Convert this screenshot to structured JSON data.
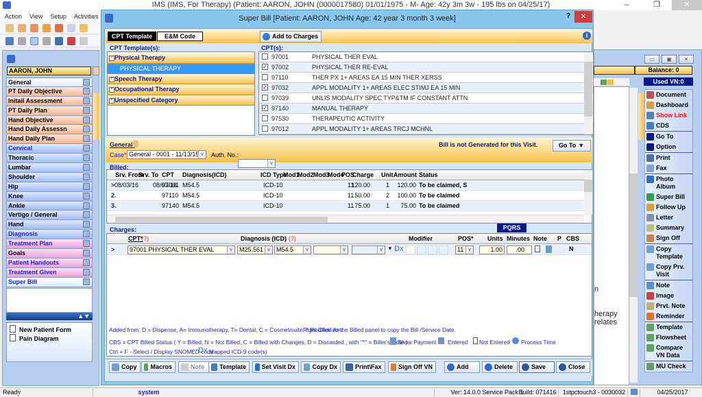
{
  "app": {
    "title": "IMS (IMS, For Therapy)    (Patient: AARON, JOHN  (0000017580) 01/01/1975 - M- Age: 42y 3m 3w - 195 lbs on 04/25/17)",
    "menu": [
      "Action",
      "View",
      "Setup",
      "Activities"
    ],
    "window_controls": [
      "–",
      "❐",
      "✕"
    ]
  },
  "left": {
    "patient_name": "AARON, JOHN",
    "nav": [
      {
        "label": "General",
        "style": "w",
        "color": "black"
      },
      {
        "label": "PT Daily Objective",
        "style": "o",
        "color": "black"
      },
      {
        "label": "Initail Assessment",
        "style": "o",
        "color": "black"
      },
      {
        "label": "PT Daily Plan",
        "style": "o",
        "color": "black"
      },
      {
        "label": "Hand Objective",
        "style": "o",
        "color": "black"
      },
      {
        "label": "Hand Daily Assessn",
        "style": "o",
        "color": "black"
      },
      {
        "label": "Hand Daily Plan",
        "style": "o",
        "color": "black"
      },
      {
        "label": "Cervical",
        "style": "bl",
        "color": "blue"
      },
      {
        "label": "Thoracic",
        "style": "bl",
        "color": "black"
      },
      {
        "label": "Lumbar",
        "style": "bl",
        "color": "black"
      },
      {
        "label": "Shoulder",
        "style": "bl",
        "color": "black"
      },
      {
        "label": "Hip",
        "style": "bl",
        "color": "black"
      },
      {
        "label": "Knee",
        "style": "bl",
        "color": "black"
      },
      {
        "label": "Ankle",
        "style": "bl",
        "color": "black"
      },
      {
        "label": "Vertigo / General",
        "style": "bl",
        "color": "black"
      },
      {
        "label": "Hand",
        "style": "bl",
        "color": "black"
      },
      {
        "label": "Diagnosis",
        "style": "bl",
        "color": "blue"
      },
      {
        "label": "Treatment Plan",
        "style": "p",
        "color": "blue"
      },
      {
        "label": "Goals",
        "style": "p",
        "color": "black"
      },
      {
        "label": "Patient Handouts",
        "style": "p",
        "color": "blue"
      },
      {
        "label": "Treatment Given",
        "style": "p",
        "color": "blue"
      },
      {
        "label": "Super Bill",
        "style": "w",
        "color": "blue"
      }
    ],
    "nav_arrows": "▲▼",
    "forms": [
      "New Patient Form",
      "Pain Diagram"
    ]
  },
  "right": {
    "balance": "Balance: 0",
    "used_vn": "Used VN:0",
    "text_fragments": [
      "n",
      "herapy",
      "relates"
    ],
    "sidebar": [
      {
        "label": "Document",
        "icon": "document-icon",
        "color": "#c05050"
      },
      {
        "label": "Dashboard",
        "icon": "dashboard-icon",
        "color": "#d0a040"
      },
      {
        "label": "Show Link",
        "icon": "link-icon",
        "color": "#5080c0",
        "red": true
      },
      {
        "label": "CDS",
        "icon": "cds-icon",
        "color": "#4080c0"
      },
      {
        "label": "Go To",
        "icon": "triangle-down-icon",
        "color": "#0a1a8a",
        "sep": true
      },
      {
        "label": "Option",
        "icon": "triangle-down-icon",
        "color": "#0a1a8a"
      },
      {
        "label": "Print",
        "icon": "print-icon",
        "color": "#5070a0",
        "sep": true
      },
      {
        "label": "Fax",
        "icon": "fax-icon",
        "color": "#80a0d0"
      },
      {
        "label": "Photo Album",
        "icon": "photo-album-icon",
        "color": "#3070c0",
        "sep": true
      },
      {
        "label": "Super Bill",
        "icon": "super-bill-icon",
        "color": "#30a050"
      },
      {
        "label": "Follow Up",
        "icon": "follow-up-icon",
        "color": "#e0a030"
      },
      {
        "label": "Letter",
        "icon": "letter-icon",
        "color": "#8090b0"
      },
      {
        "label": "Summary",
        "icon": "summary-icon",
        "color": "#c0c080"
      },
      {
        "label": "Sign Off",
        "icon": "sign-off-icon",
        "color": "#d08040"
      },
      {
        "label": "Copy Template",
        "icon": "copy-icon",
        "color": "#70a0d0",
        "sep": true
      },
      {
        "label": "Copy Prv. Visit",
        "icon": "copy-icon",
        "color": "#70a0d0"
      },
      {
        "label": "Note",
        "icon": "note-icon",
        "color": "#5090d0",
        "sep": true
      },
      {
        "label": "Image",
        "icon": "image-icon",
        "color": "#d04040"
      },
      {
        "label": "Prvt. Note",
        "icon": "private-note-icon",
        "color": "#c0b070"
      },
      {
        "label": "Reminder",
        "icon": "reminder-icon",
        "color": "#e07030"
      },
      {
        "label": "Template",
        "icon": "template-icon",
        "color": "#60a060",
        "sep": true
      },
      {
        "label": "Flowsheet",
        "icon": "flowsheet-icon",
        "color": "#60a060"
      },
      {
        "label": "Compare VN Data",
        "icon": "compare-icon",
        "color": "#60a060"
      },
      {
        "label": "MU Check",
        "icon": "check-icon",
        "color": "#60a060",
        "sep": true
      }
    ]
  },
  "modal": {
    "title": "Super Bill  [Patient: AARON, JOHN   Age: 42 year 3 month 3 week]",
    "help": "?",
    "close": "✕",
    "tabs": [
      "CPT Template",
      "E&M Code"
    ],
    "add_to_charges": "Add to Charges",
    "info": "i",
    "cpt_templates_label": "CPT Template(s):",
    "tree": {
      "open": "Physical Therapy",
      "selected": "PHYSICAL THERAPY",
      "others": [
        "Speech Therapy",
        "Occupational Therapy",
        "Unspecified Category"
      ]
    },
    "cpts_label": "CPT(s):",
    "cpts": [
      {
        "code": "97001",
        "desc": "PHYSICAL THER EVAL",
        "checked": false
      },
      {
        "code": "97002",
        "desc": "PHYSICAL THER RE-EVAL",
        "checked": true
      },
      {
        "code": "97110",
        "desc": "THER PX 1+ AREAS EA 15 MIN THER XERSS",
        "checked": false
      },
      {
        "code": "97032",
        "desc": "APPL MODALITY 1+ AREAS ELEC STIMJ EA 15 MIN",
        "checked": true
      },
      {
        "code": "97039",
        "desc": "UNLIS MODALITY SPEC TYP&TM IF CONSTANT ATTN",
        "checked": false
      },
      {
        "code": "97140",
        "desc": "MANUAL THERAPY",
        "checked": true
      },
      {
        "code": "97530",
        "desc": "THERAPEUTIC ACTIVITY",
        "checked": false
      },
      {
        "code": "97012",
        "desc": "APPL MODALITY 1+ AREAS TRCJ MCHNL",
        "checked": false
      }
    ],
    "general": {
      "label": "General:",
      "bill_status": "Bill is not Generated for this Visit.",
      "goto": "Go To",
      "case_label": "Case*",
      "case_value": "General  -  0001 - 11/13/15",
      "auth_label": "Auth. No.:",
      "auth_value": ""
    },
    "billed_label": "Billed:",
    "billed_columns": [
      "Srv. From",
      "Srv. To",
      "CPT",
      "Diagnosis(ICD)",
      "ICD Type",
      "Mod1",
      "Mod2",
      "Mod3",
      "Mod4",
      "POS",
      "Charge",
      "Unit",
      "Amount",
      "Status"
    ],
    "billed_rows": [
      {
        "idx": ">",
        "from": "08/03/16",
        "to": "08/03/16",
        "cpt": "97001",
        "dx": "M54.5",
        "icd": "ICD-10",
        "pos": "11",
        "charge": "120.00",
        "unit": "1",
        "amount": "120.00",
        "status": "To be claimed, S"
      },
      {
        "idx": "2.",
        "from": "",
        "to": "",
        "cpt": "97110",
        "dx": "M54.5",
        "icd": "ICD-10",
        "pos": "11",
        "charge": "50.00",
        "unit": "2",
        "amount": "100.00",
        "status": "To be claimed"
      },
      {
        "idx": "3.",
        "from": "",
        "to": "",
        "cpt": "97140",
        "dx": "M54.5",
        "icd": "ICD-10",
        "pos": "11",
        "charge": "75.00",
        "unit": "1",
        "amount": "75.00",
        "status": "To be claimed"
      }
    ],
    "charges_label": "Charges:",
    "pqrs": "PQRS",
    "charges_columns": {
      "cpt": "CPT*",
      "cpt_help": "(?)",
      "dx": "Diagnosis (ICD)",
      "dx_help": "(?)",
      "modifier": "Modifier",
      "pos": "POS*",
      "units": "Units",
      "minutes": "Minutes",
      "note": "Note",
      "p": "P",
      "cbs": "CBS"
    },
    "charge_row": {
      "idx": ">",
      "cpt": "97001    PHYSICAL THER EVAL",
      "dx1": "M25.561",
      "dx2": "M54.5",
      "dx3": "",
      "dx4": "",
      "dx_label": "Dx",
      "pos": "11",
      "units": "1.00",
      "minutes": ".00",
      "cbs": "N"
    },
    "legend": [
      "Added from: D = Dispense, A= Immunotherapy, T= Dental,  C = Cosmetisuite,   * Modified Amt",
      "Right Click on the Billed panel to copy the Bill /Service Date.",
      "CBS = CPT Billed Status ( Y = Billed, N = Not Billed, C = Billed with Changes, D = Discarded , with \"*\" = Biller's Note )",
      "Show Payment",
      "Entered",
      "Not Entered",
      "Process Time",
      "Ctrl + F - Select / Display SNOMED code",
      "Mapped ICD-9 code(s)"
    ],
    "buttons_left": [
      "Copy",
      "Macros",
      "Note",
      "Template",
      "Set Visit Dx",
      "Copy Dx",
      "Print\\Fax",
      "Sign Off VN"
    ],
    "buttons_right": [
      "Add",
      "Delete",
      "Save",
      "Close"
    ]
  },
  "status": {
    "ready": "Ready",
    "user": "system",
    "version": "Ver: 14.0.0 Service Pack 1",
    "build": "Build: 071416",
    "station": "1stpctouch3 - 0030032",
    "date": "04/25/2017"
  }
}
